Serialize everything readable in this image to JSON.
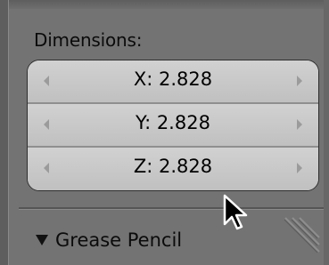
{
  "panel": {
    "dimensions_label": "Dimensions:",
    "fields": [
      {
        "label": "X: 2.828"
      },
      {
        "label": "Y: 2.828"
      },
      {
        "label": "Z: 2.828"
      }
    ]
  },
  "grease_pencil": {
    "label": "Grease Pencil",
    "expand_icon": "triangle-down-icon"
  },
  "colors": {
    "panel_bg": "#737373",
    "field_bg": "#c7c7c7",
    "text": "#000000"
  }
}
